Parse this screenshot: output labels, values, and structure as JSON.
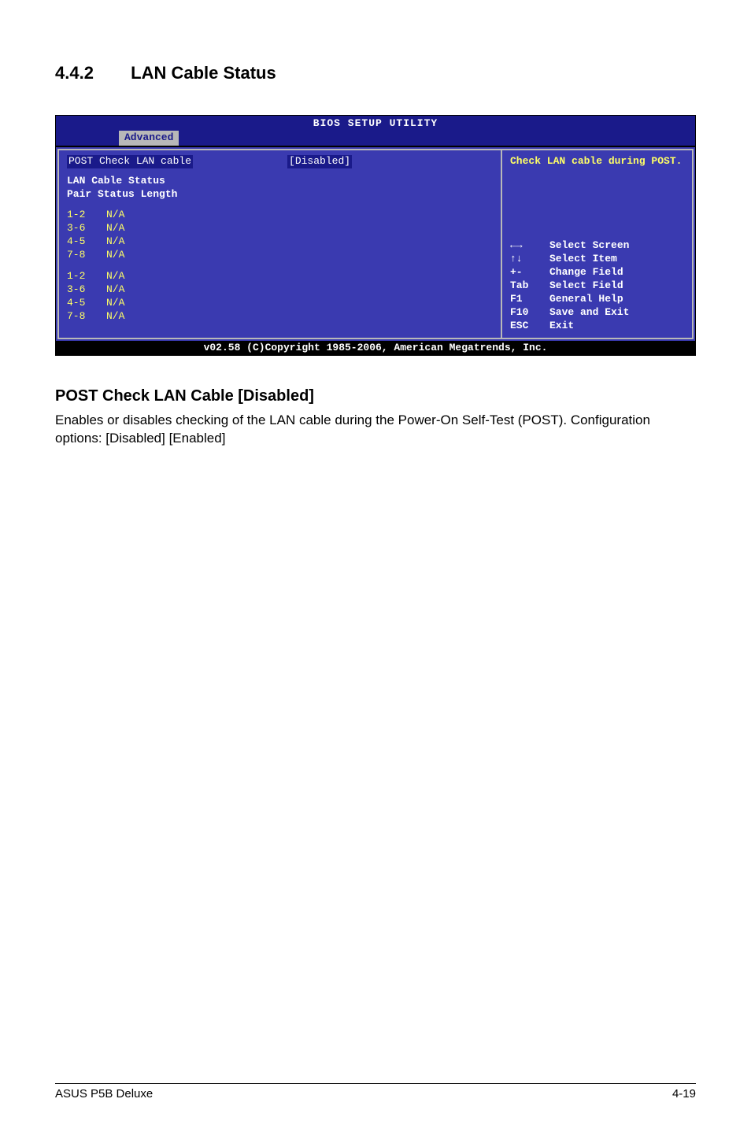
{
  "heading": {
    "number": "4.4.2",
    "title": "LAN Cable Status"
  },
  "bios": {
    "title": "BIOS SETUP UTILITY",
    "tab": "Advanced",
    "field": {
      "label": "POST Check LAN cable",
      "value": "[Disabled]"
    },
    "status_header": "LAN Cable Status",
    "columns": "Pair  Status  Length",
    "block1": [
      {
        "pair": "1-2",
        "status": "N/A"
      },
      {
        "pair": "3-6",
        "status": "N/A"
      },
      {
        "pair": "4-5",
        "status": "N/A"
      },
      {
        "pair": "7-8",
        "status": "N/A"
      }
    ],
    "block2": [
      {
        "pair": "1-2",
        "status": "N/A"
      },
      {
        "pair": "3-6",
        "status": "N/A"
      },
      {
        "pair": "4-5",
        "status": "N/A"
      },
      {
        "pair": "7-8",
        "status": "N/A"
      }
    ],
    "help_text": "Check LAN cable during POST.",
    "keys": [
      {
        "k": "←→",
        "d": "Select Screen"
      },
      {
        "k": "↑↓",
        "d": "Select Item"
      },
      {
        "k": "+-",
        "d": "Change Field"
      },
      {
        "k": "Tab",
        "d": "Select Field"
      },
      {
        "k": "F1",
        "d": "General Help"
      },
      {
        "k": "F10",
        "d": "Save and Exit"
      },
      {
        "k": "ESC",
        "d": "Exit"
      }
    ],
    "footer": "v02.58 (C)Copyright 1985-2006, American Megatrends, Inc."
  },
  "sub": {
    "heading": "POST Check LAN Cable  [Disabled]",
    "body": "Enables or disables checking of the LAN cable during the Power-On Self-Test (POST). Configuration options: [Disabled] [Enabled]"
  },
  "footer": {
    "left": "ASUS P5B Deluxe",
    "right": "4-19"
  }
}
